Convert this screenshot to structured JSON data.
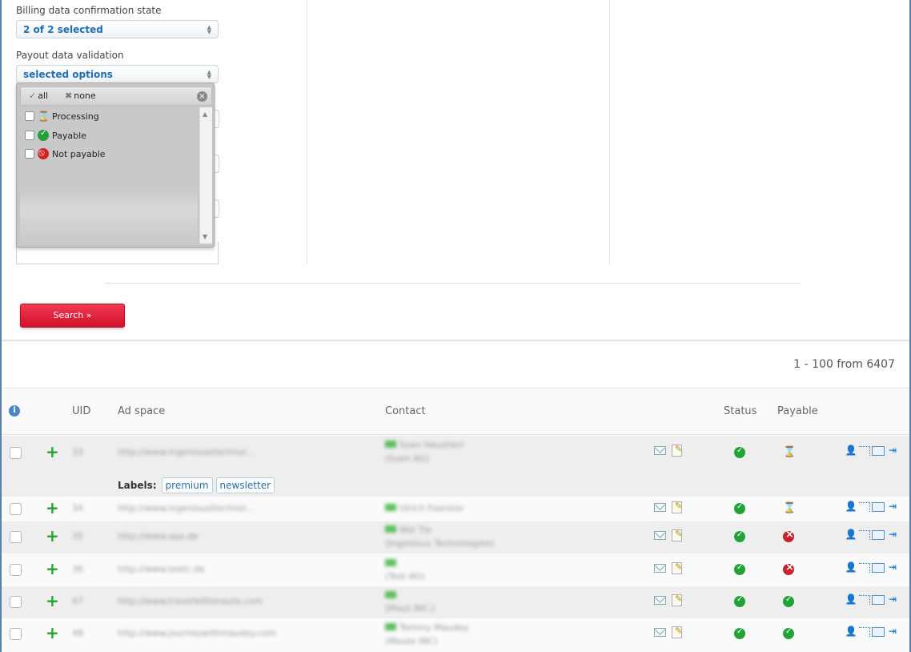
{
  "filters": {
    "billing_label": "Billing data confirmation state",
    "billing_value": "2 of 2 selected",
    "payout_label": "Payout data validation",
    "payout_value": "selected options",
    "dropdown": {
      "all_label": "all",
      "none_label": "none",
      "options": [
        {
          "label": "Processing",
          "icon": "hourglass-icon"
        },
        {
          "label": "Payable",
          "icon": "check-circle-icon"
        },
        {
          "label": "Not payable",
          "icon": "forbidden-icon"
        }
      ]
    },
    "search_label": "Search »"
  },
  "pager": {
    "text": "1 - 100 from 6407"
  },
  "table": {
    "headers": {
      "uid": "UID",
      "adspace": "Ad space",
      "contact": "Contact",
      "status": "Status",
      "payable": "Payable"
    },
    "labels_title": "Labels:",
    "rows": [
      {
        "uid": "33",
        "adspace": "http://www.ingeniousltechnol...",
        "contact": "Sven Heusherr",
        "company": "(Sven AG)",
        "status": "ok",
        "payable": "processing",
        "labels": [
          "premium",
          "newsletter"
        ]
      },
      {
        "uid": "34",
        "adspace": "http://www.ingeniousltechnol...",
        "contact": "Ulrich Foerster",
        "company": "",
        "status": "ok",
        "payable": "processing",
        "labels": []
      },
      {
        "uid": "35",
        "adspace": "http://www.aaa.de",
        "contact": "Wei Tie",
        "company": "(Ingenious Technologies)",
        "status": "ok",
        "payable": "not-payable",
        "labels": []
      },
      {
        "uid": "36",
        "adspace": "http://www.teetc.de",
        "contact": "",
        "company": "(Test AG)",
        "status": "ok",
        "payable": "not-payable",
        "labels": []
      },
      {
        "uid": "47",
        "adspace": "http://www.travelwithmaute.com",
        "contact": "",
        "company": "(Maut INC.)",
        "status": "ok",
        "payable": "payable",
        "labels": []
      },
      {
        "uid": "48",
        "adspace": "http://www.journeywithmaudey.com",
        "contact": "Tommy Maudey",
        "company": "(Maute INC)",
        "status": "ok",
        "payable": "payable",
        "labels": []
      }
    ]
  }
}
